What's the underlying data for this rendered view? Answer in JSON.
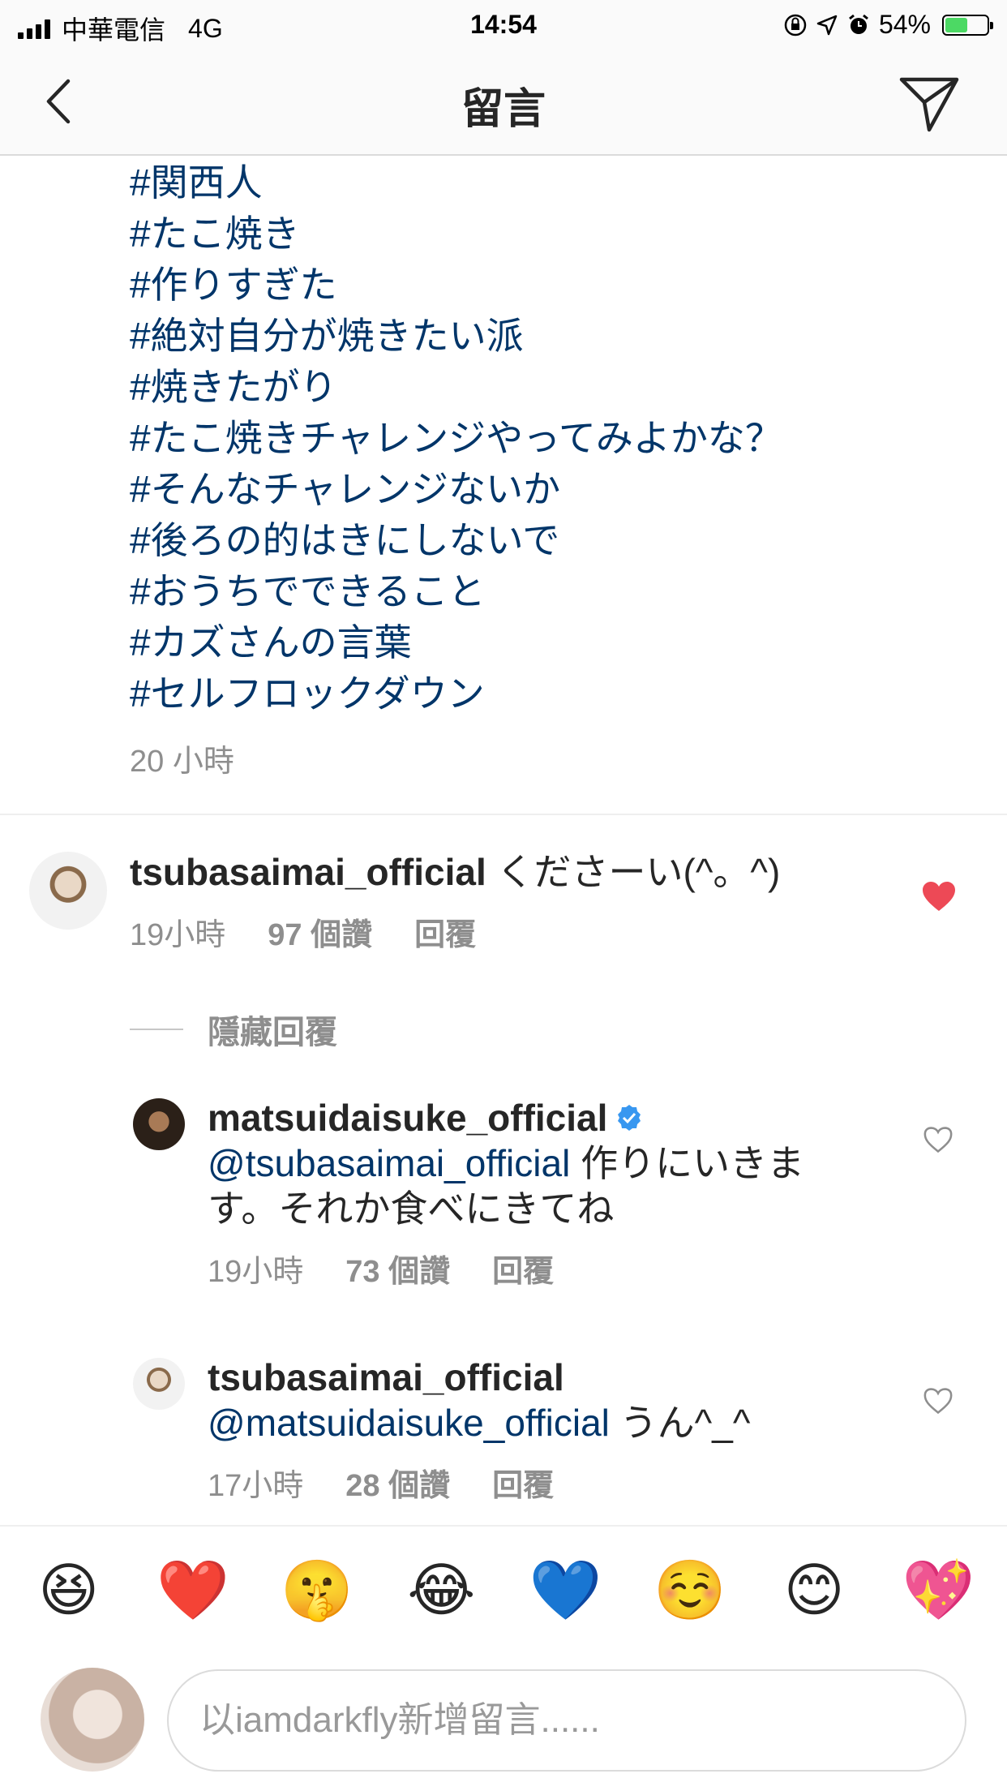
{
  "status_bar": {
    "carrier": "中華電信",
    "network": "4G",
    "time": "14:54",
    "battery": "54%",
    "battery_level": 0.54
  },
  "nav": {
    "title": "留言",
    "back_icon": "chevron-left-icon",
    "send_icon": "paper-plane-icon"
  },
  "caption": {
    "hashtags": [
      "#関西人",
      "#たこ焼き",
      "#作りすぎた",
      "#絶対自分が焼きたい派",
      "#焼きたがり",
      "#たこ焼きチャレンジやってみよかな？",
      "#そんなチャレンジないか",
      "#後ろの的はきにしないで",
      "#おうちでできること",
      "#カズさんの言葉",
      "#セルフロックダウン"
    ],
    "time": "20 小時"
  },
  "comments": [
    {
      "username": "tsubasaimai_official",
      "text": "くださーい(^。^)",
      "time": "19小時",
      "likes": "97 個讚",
      "reply": "回覆",
      "liked": true
    }
  ],
  "hide_replies": "隱藏回覆",
  "replies": [
    {
      "username": "matsuidaisuke_official",
      "verified": true,
      "mention": "@tsubasaimai_official",
      "text_line1": " 作りにいきま",
      "text_line2": "す。それか食べにきてね",
      "time": "19小時",
      "likes": "73 個讚",
      "reply": "回覆",
      "liked": false
    },
    {
      "username": "tsubasaimai_official",
      "verified": false,
      "mention": "@matsuidaisuke_official",
      "text": " うん^_^",
      "time": "17小時",
      "likes": "28 個讚",
      "reply": "回覆",
      "liked": false
    }
  ],
  "emoji_bar": [
    "😆",
    "❤️",
    "🤫",
    "😂",
    "💙",
    "☺️",
    "😊",
    "💖"
  ],
  "input": {
    "placeholder": "以iamdarkfly新增留言......"
  },
  "colors": {
    "hashtag": "#003569",
    "liked_heart": "#ed4956",
    "meta_gray": "#8e8e8e",
    "verified_blue": "#3897f0"
  }
}
